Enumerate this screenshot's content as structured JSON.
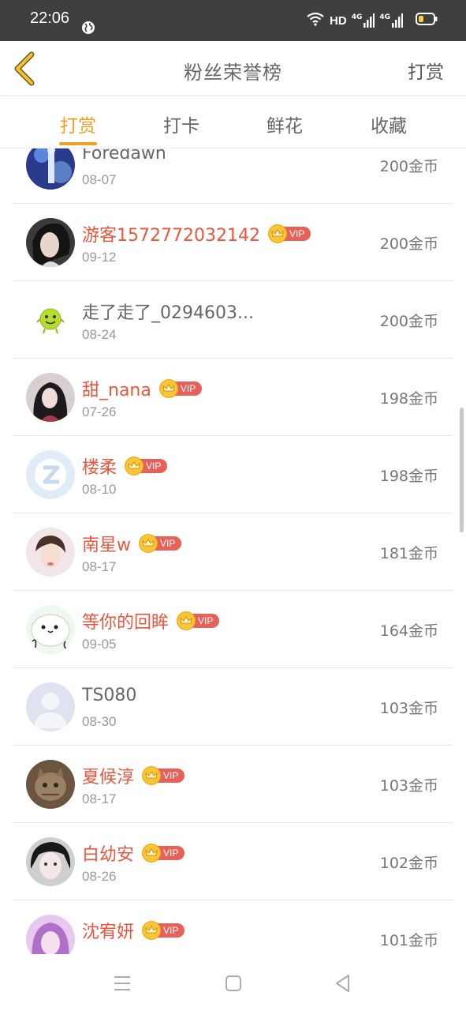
{
  "status_bar": {
    "time": "22:06",
    "network": "HD",
    "signal_1": "4G",
    "signal_2": "4G"
  },
  "header": {
    "title": "粉丝荣誉榜",
    "action_label": "打赏"
  },
  "tabs": [
    {
      "label": "打赏",
      "active": true
    },
    {
      "label": "打卡",
      "active": false
    },
    {
      "label": "鲜花",
      "active": false
    },
    {
      "label": "收藏",
      "active": false
    }
  ],
  "vip_label": "VIP",
  "accent_color": "#f0a020",
  "vip_name_color": "#e8563e",
  "list": [
    {
      "name": "Foredawn",
      "date": "08-07",
      "amount": "200金币",
      "vip": false
    },
    {
      "name": "游客1572772032142",
      "date": "09-12",
      "amount": "200金币",
      "vip": true
    },
    {
      "name": "走了走了_0294603...",
      "date": "08-24",
      "amount": "200金币",
      "vip": false
    },
    {
      "name": "甜_nana",
      "date": "07-26",
      "amount": "198金币",
      "vip": true
    },
    {
      "name": "楼柔",
      "date": "08-10",
      "amount": "198金币",
      "vip": true
    },
    {
      "name": "南星w",
      "date": "08-17",
      "amount": "181金币",
      "vip": true
    },
    {
      "name": "等你的回眸",
      "date": "09-05",
      "amount": "164金币",
      "vip": true
    },
    {
      "name": "TS080",
      "date": "08-30",
      "amount": "103金币",
      "vip": false
    },
    {
      "name": "夏候淳",
      "date": "08-17",
      "amount": "103金币",
      "vip": true
    },
    {
      "name": "白幼安",
      "date": "08-26",
      "amount": "102金币",
      "vip": true
    },
    {
      "name": "沈宥妍",
      "date": "",
      "amount": "101金币",
      "vip": true
    }
  ]
}
